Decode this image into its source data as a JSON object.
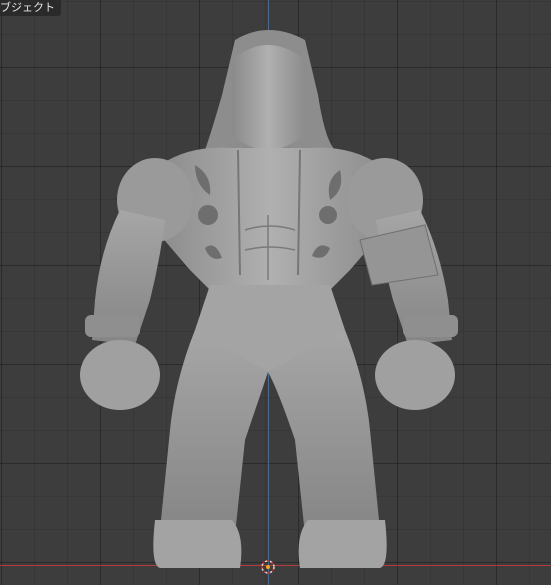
{
  "viewport": {
    "mode_label": "ブジェクト",
    "background": "#3d3d3d",
    "grid_color": "#2e2e2e",
    "axis_y_color": "#2f6fb8",
    "axis_x_color": "#b23a3a",
    "model_color": "#9c9c9c"
  },
  "icons": {
    "origin": "3d-cursor-icon"
  }
}
